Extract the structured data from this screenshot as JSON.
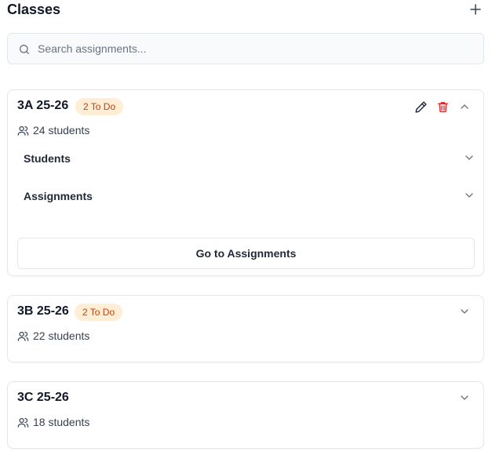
{
  "header": {
    "title": "Classes",
    "add_icon": "plus-icon"
  },
  "search": {
    "placeholder": "Search assignments...",
    "value": ""
  },
  "classes": [
    {
      "name": "3A 25-26",
      "badge": "2 To Do",
      "students": "24 students",
      "expanded": true,
      "sections": [
        {
          "label": "Students"
        },
        {
          "label": "Assignments"
        }
      ],
      "action_label": "Go to Assignments"
    },
    {
      "name": "3B 25-26",
      "badge": "2 To Do",
      "students": "22 students",
      "expanded": false
    },
    {
      "name": "3C 25-26",
      "students": "18 students",
      "expanded": false
    }
  ],
  "colors": {
    "badge_bg": "#ffedd5",
    "badge_text": "#c2410c",
    "delete_icon": "#dc2626",
    "border": "#e5e7eb"
  }
}
